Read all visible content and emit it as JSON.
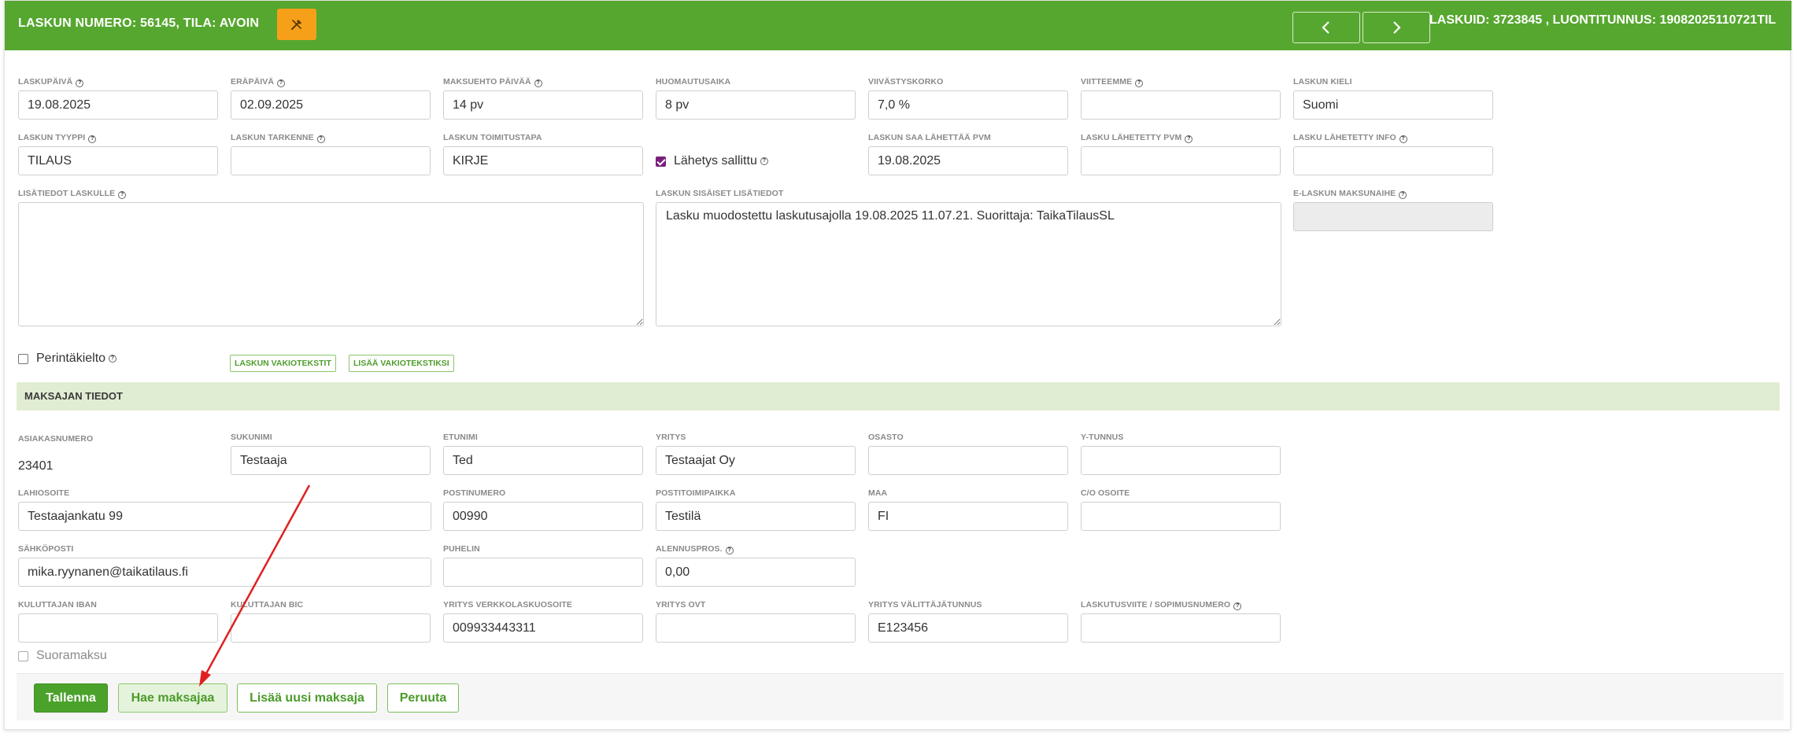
{
  "header": {
    "title": "LASKUN NUMERO: 56145, TILA: AVOIN",
    "ids": "LASKUID: 3723845 , LUONTITUNNUS: 19082025110721TIL"
  },
  "fields": {
    "laskupaiva": {
      "label": "LASKUPÄIVÄ",
      "value": "19.08.2025"
    },
    "erapaiva": {
      "label": "ERÄPÄIVÄ",
      "value": "02.09.2025"
    },
    "maksuehto": {
      "label": "MAKSUEHTO PÄIVÄÄ",
      "value": "14 pv"
    },
    "huomautusaika": {
      "label": "HUOMAUTUSAIKA",
      "value": "8 pv"
    },
    "viivastyskorko": {
      "label": "VIIVÄSTYSKORKO",
      "value": "7,0 %"
    },
    "viitteemme": {
      "label": "VIITTEEMME",
      "value": ""
    },
    "laskun_kieli": {
      "label": "LASKUN KIELI",
      "value": "Suomi"
    },
    "laskun_tyyppi": {
      "label": "LASKUN TYYPPI",
      "value": "TILAUS"
    },
    "laskun_tarkenne": {
      "label": "LASKUN TARKENNE",
      "value": ""
    },
    "laskun_toimitustapa": {
      "label": "LASKUN TOIMITUSTAPA",
      "value": "KIRJE"
    },
    "lahetys_sallittu": {
      "label": "Lähetys sallittu",
      "checked": true
    },
    "saa_lahettaa_pvm": {
      "label": "LASKUN SAA LÄHETTÄÄ PVM",
      "value": "19.08.2025"
    },
    "lahetetty_pvm": {
      "label": "LASKU LÄHETETTY PVM",
      "value": ""
    },
    "lahetetty_info": {
      "label": "LASKU LÄHETETTY INFO",
      "value": ""
    },
    "lisatiedot": {
      "label": "LISÄTIEDOT LASKULLE",
      "value": ""
    },
    "sisaiset_lisatiedot": {
      "label": "LASKUN SISÄISET LISÄTIEDOT",
      "value": "Lasku muodostettu laskutusajolla 19.08.2025 11.07.21. Suorittaja: TaikaTilausSL"
    },
    "e_laskun_maksunaihe": {
      "label": "E-LASKUN MAKSUNAIHE",
      "value": ""
    },
    "perintakielto": {
      "label": "Perintäkielto",
      "checked": false
    }
  },
  "tag_buttons": {
    "vakiotekstit": "LASKUN VAKIOTEKSTIT",
    "lisaa_vakioteksti": "LISÄÄ VAKIOTEKSTIKSI"
  },
  "section": {
    "title": "MAKSAJAN TIEDOT"
  },
  "payer": {
    "asiakasnumero": {
      "label": "ASIAKASNUMERO",
      "value": "23401"
    },
    "sukunimi": {
      "label": "SUKUNIMI",
      "value": "Testaaja"
    },
    "etunimi": {
      "label": "ETUNIMI",
      "value": "Ted"
    },
    "yritys": {
      "label": "YRITYS",
      "value": "Testaajat Oy"
    },
    "osasto": {
      "label": "OSASTO",
      "value": ""
    },
    "y_tunnus": {
      "label": "Y-TUNNUS",
      "value": ""
    },
    "lahiosoite": {
      "label": "LAHIOSOITE",
      "value": "Testaajankatu 99"
    },
    "postinumero": {
      "label": "POSTINUMERO",
      "value": "00990"
    },
    "postitoimipaikka": {
      "label": "POSTITOIMIPAIKKA",
      "value": "Testilä"
    },
    "maa": {
      "label": "MAA",
      "value": "FI"
    },
    "co_osoite": {
      "label": "C/O OSOITE",
      "value": ""
    },
    "sahkoposti": {
      "label": "SÄHKÖPOSTI",
      "value": "mika.ryynanen@taikatilaus.fi"
    },
    "puhelin": {
      "label": "PUHELIN",
      "value": ""
    },
    "alennuspros": {
      "label": "ALENNUSPROS.",
      "value": "0,00"
    },
    "iban": {
      "label": "KULUTTAJAN IBAN",
      "value": ""
    },
    "bic": {
      "label": "KULUTTAJAN BIC",
      "value": ""
    },
    "verkkolaskuosoite": {
      "label": "YRITYS VERKKOLASKUOSOITE",
      "value": "009933443311"
    },
    "ovt": {
      "label": "YRITYS OVT",
      "value": ""
    },
    "valittajatunnus": {
      "label": "YRITYS VÄLITTÄJÄTUNNUS",
      "value": "E123456"
    },
    "laskutusviite": {
      "label": "LASKUTUSVIITE / SOPIMUSNUMERO",
      "value": ""
    },
    "suoramaksu": {
      "label": "Suoramaksu",
      "checked": false
    }
  },
  "footer": {
    "tallenna": "Tallenna",
    "hae_maksajaa": "Hae maksajaa",
    "lisaa_uusi_maksaja": "Lisää uusi maksaja",
    "peruuta": "Peruuta"
  },
  "colors": {
    "header_bg": "#56a72f",
    "accent_orange": "#f6a01a",
    "section_bg": "#e1edd3",
    "checkbox_checked": "#7b1f7e",
    "annotation_arrow": "#e02020"
  },
  "icons": {
    "tool": "tools-icon",
    "prev": "chevron-left-icon",
    "next": "chevron-right-icon",
    "help": "help-icon"
  }
}
